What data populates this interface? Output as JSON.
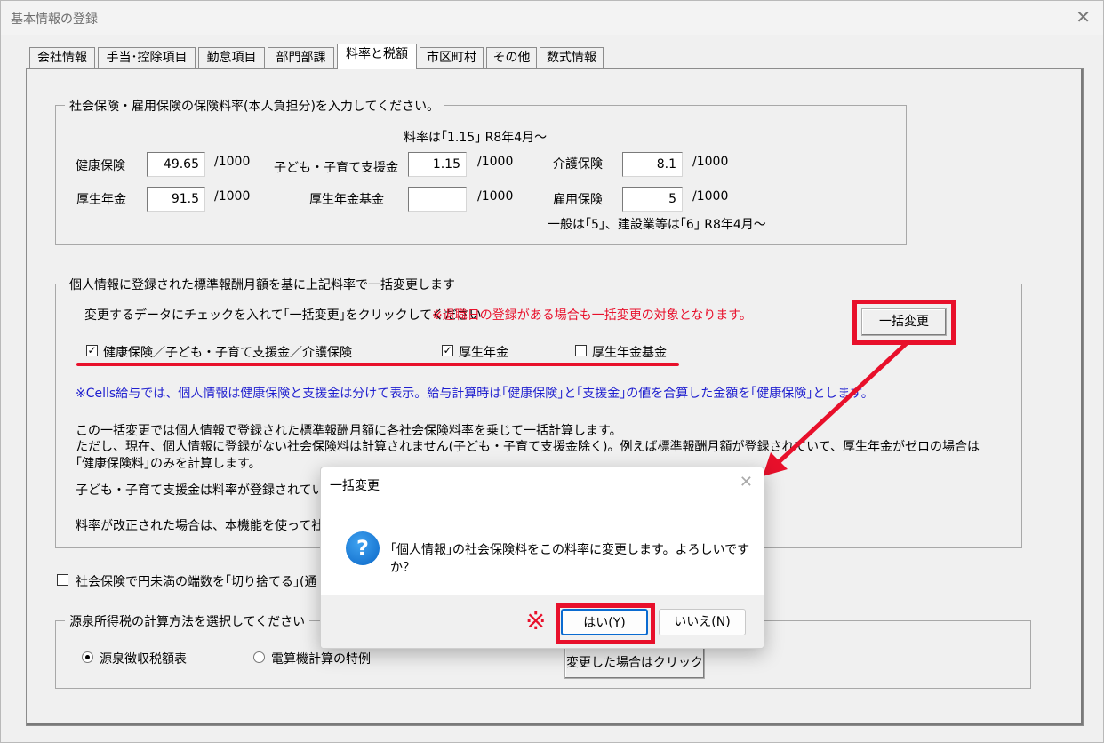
{
  "window": {
    "title": "基本情報の登録",
    "close_glyph": "✕"
  },
  "tabs": [
    "会社情報",
    "手当･控除項目",
    "勤怠項目",
    "部門部課",
    "料率と税額",
    "市区町村",
    "その他",
    "数式情報"
  ],
  "rates": {
    "legend": "社会保険・雇用保険の保険料率(本人負担分)を入力してください。",
    "note_top": "料率は｢1.15｣ R8年4月～",
    "kenko_label": "健康保険",
    "kenko_value": "49.65",
    "kodomo_label": "子ども・子育て支援金",
    "kodomo_value": "1.15",
    "kaigo_label": "介護保険",
    "kaigo_value": "8.1",
    "kosei_label": "厚生年金",
    "kosei_value": "91.5",
    "kikin_label": "厚生年金基金",
    "kikin_value": "",
    "koyo_label": "雇用保険",
    "koyo_value": "5",
    "unit": "/1000",
    "note_bottom": "一般は｢5｣、建設業等は｢6｣ R8年4月～"
  },
  "bulk": {
    "legend": "個人情報に登録された標準報酬月額を基に上記料率で一括変更します",
    "instruction": "変更するデータにチェックを入れて｢一括変更｣をクリックしてください",
    "warning": "※退職日の登録がある場合も一括変更の対象となります。",
    "check1_label": "健康保険／子ども・子育て支援金／介護保険",
    "check2_label": "厚生年金",
    "check3_label": "厚生年金基金",
    "check_mark": "✓",
    "blue_note": "※Cells給与では、個人情報は健康保険と支援金は分けて表示。給与計算時は｢健康保険｣と｢支援金｣の値を合算した金額を｢健康保険｣とします。",
    "desc1": "この一括変更では個人情報で登録された標準報酬月額に各社会保険料率を乗じて一括計算します。",
    "desc2": "ただし、現在、個人情報に登録がない社会保険料は計算されません(子ども・子育て支援金除く)。例えば標準報酬月額が登録されていて、厚生年金がゼロの場合は",
    "desc3": "｢健康保険料｣のみを計算します。",
    "desc4": "子ども・子育て支援金は料率が登録されていて、",
    "desc5": "料率が改正された場合は、本機能を使って社員",
    "button": "一括変更"
  },
  "rounding": {
    "label": "社会保険で円未満の端数を｢切り捨てる｣(通"
  },
  "tax": {
    "legend": "源泉所得税の計算方法を選択してください",
    "radio1": "源泉徴収税額表",
    "radio2": "電算機計算の特例",
    "button": "変更した場合はクリック"
  },
  "dialog": {
    "title": "一括変更",
    "close_glyph": "✕",
    "icon_glyph": "?",
    "message": "｢個人情報｣の社会保険料をこの料率に変更します。よろしいですか？",
    "yes": "はい(Y)",
    "no": "いいえ(N)",
    "note_mark": "※"
  },
  "colors": {
    "annotation_red": "#e8102b",
    "note_blue": "#1f1fcf",
    "focus_blue": "#0a6bd1"
  }
}
